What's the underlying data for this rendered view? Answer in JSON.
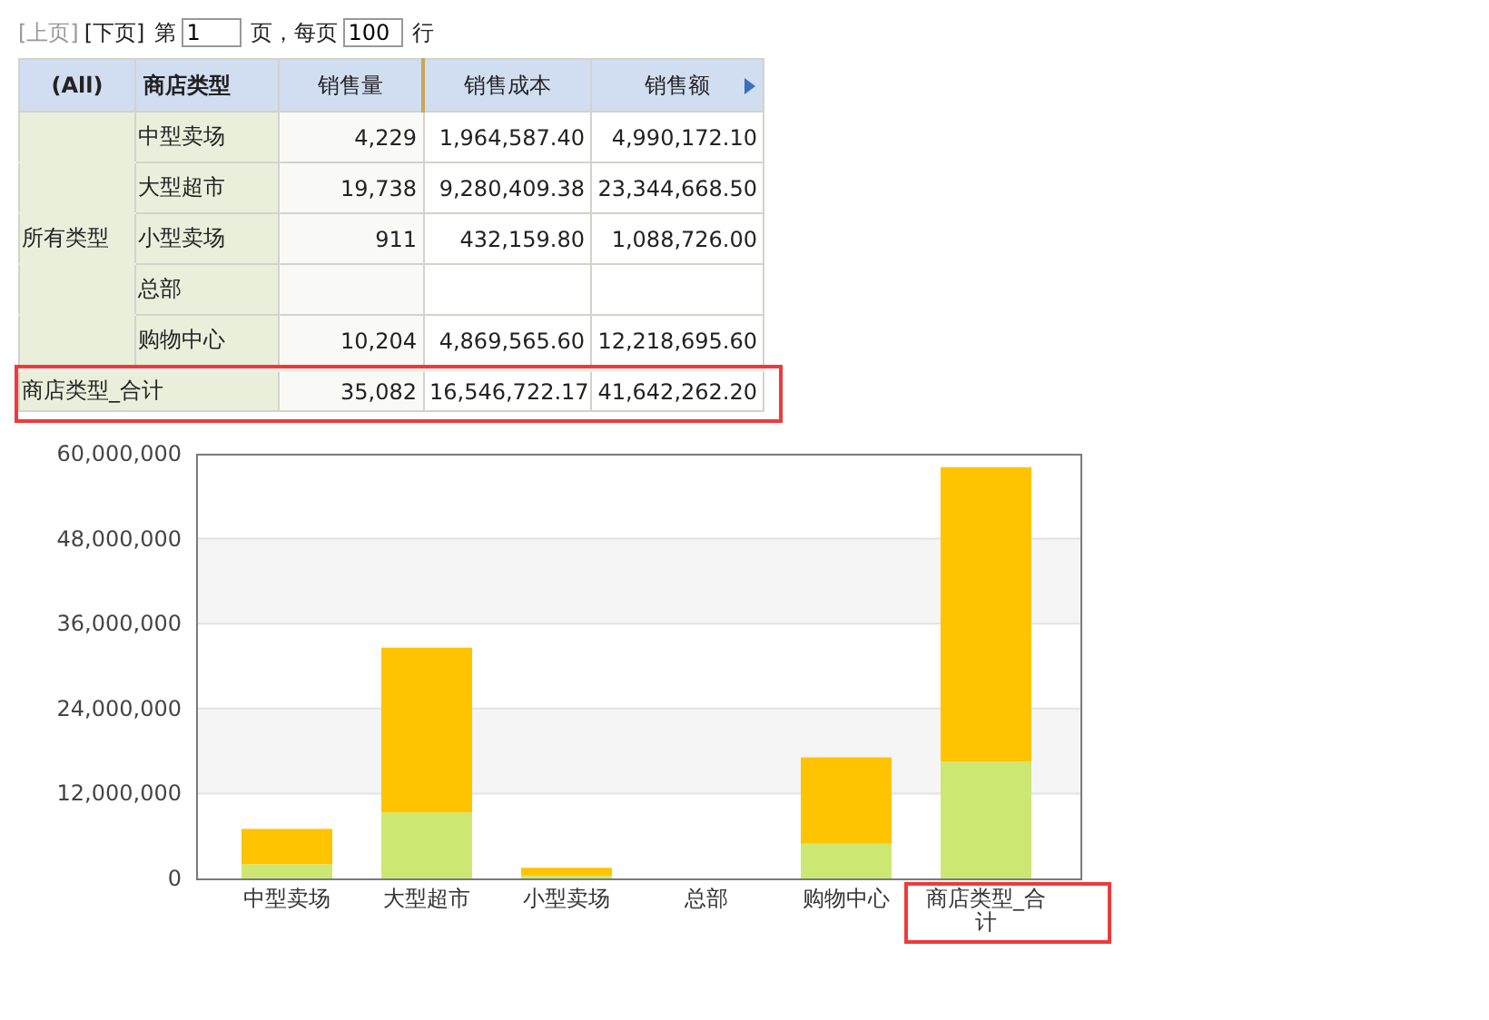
{
  "pager": {
    "prev": {
      "label": "[上页]",
      "disabled": true
    },
    "next": {
      "label": "[下页]",
      "disabled": false
    },
    "page_prefix": "第",
    "page_value": "1",
    "page_suffix": "页，每页",
    "rows_value": "100",
    "rows_suffix": "行"
  },
  "table": {
    "columns": [
      "(All)",
      "商店类型",
      "销售量",
      "销售成本",
      "销售额"
    ],
    "rows": [
      {
        "cells": [
          "",
          "中型卖场",
          "4,229",
          "1,964,587.40",
          "4,990,172.10"
        ]
      },
      {
        "cells": [
          "",
          "大型超市",
          "19,738",
          "9,280,409.38",
          "23,344,668.50"
        ]
      },
      {
        "cells": [
          "所有类型",
          "小型卖场",
          "911",
          "432,159.80",
          "1,088,726.00"
        ]
      },
      {
        "cells": [
          "",
          "总部",
          "",
          "",
          ""
        ]
      },
      {
        "cells": [
          "",
          "购物中心",
          "10,204",
          "4,869,565.60",
          "12,218,695.60"
        ]
      }
    ],
    "total_row": {
      "label": "商店类型_合计",
      "cells": [
        "35,082",
        "16,546,722.17",
        "41,642,262.20"
      ],
      "highlighted": true
    }
  },
  "chart": {
    "highlight_last_category": true,
    "chart_data": {
      "type": "bar",
      "stacked": true,
      "grid": true,
      "categories": [
        "中型卖场",
        "大型超市",
        "小型卖场",
        "总部",
        "购物中心",
        "商店类型_合计"
      ],
      "series": [
        {
          "color": "#cce872",
          "values": [
            2000000,
            9300000,
            400000,
            null,
            4900000,
            16500000
          ]
        },
        {
          "color": "#ffc300",
          "values": [
            5000000,
            23300000,
            1100000,
            null,
            12200000,
            41600000
          ]
        }
      ],
      "ylim": [
        0,
        60000000
      ],
      "yticks": [
        {
          "value": 0,
          "label": "0"
        },
        {
          "value": 12000000,
          "label": "12,000,000"
        },
        {
          "value": 24000000,
          "label": "24,000,000"
        },
        {
          "value": 36000000,
          "label": "36,000,000"
        },
        {
          "value": 48000000,
          "label": "48,000,000"
        },
        {
          "value": 60000000,
          "label": "60,000,000"
        }
      ]
    }
  }
}
